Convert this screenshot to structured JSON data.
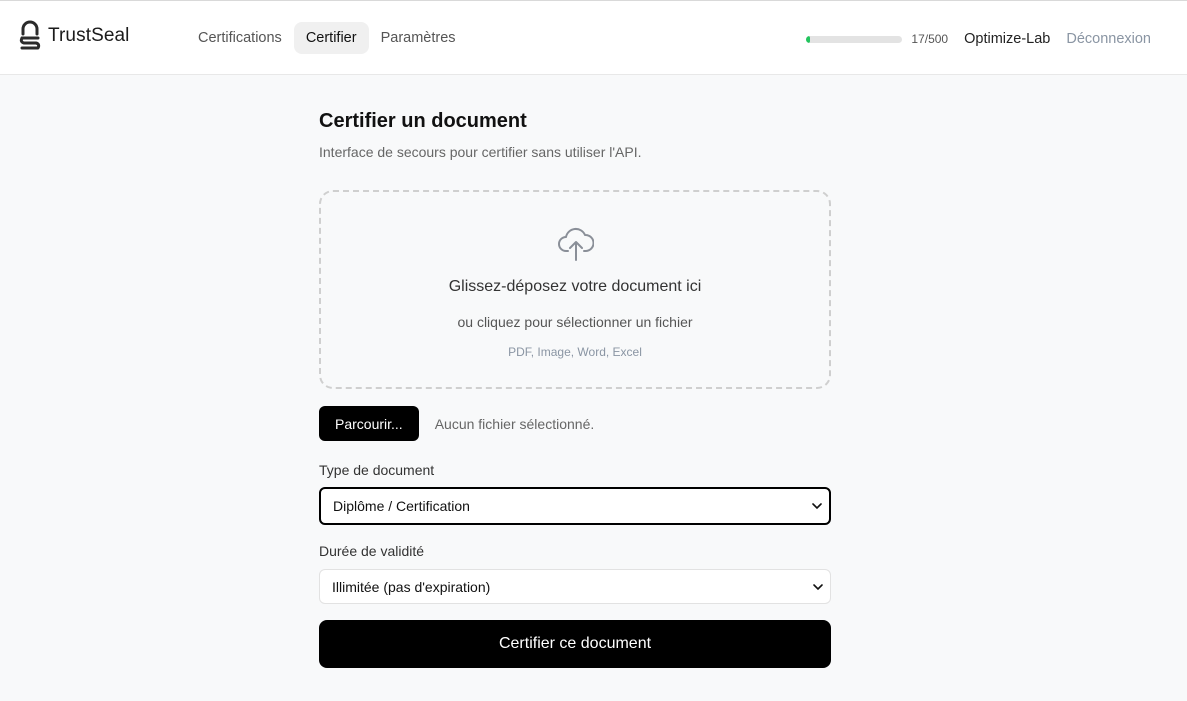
{
  "brand": {
    "name": "TrustSeal"
  },
  "nav": {
    "tabs": [
      {
        "label": "Certifications",
        "active": false
      },
      {
        "label": "Certifier",
        "active": true
      },
      {
        "label": "Paramètres",
        "active": false
      }
    ]
  },
  "account": {
    "quota_text": "17/500",
    "quota_fraction": 0.034,
    "organization": "Optimize-Lab",
    "logout_label": "Déconnexion"
  },
  "page": {
    "title": "Certifier un document",
    "subtitle": "Interface de secours pour certifier sans utiliser l'API."
  },
  "dropzone": {
    "title": "Glissez-déposez votre document ici",
    "subtitle": "ou cliquez pour sélectionner un fichier",
    "formats": "PDF, Image, Word, Excel",
    "icon": "cloud-upload-icon"
  },
  "file_input": {
    "button_label": "Parcourir...",
    "status": "Aucun fichier sélectionné."
  },
  "form": {
    "type_label": "Type de document",
    "type_value": "Diplôme / Certification",
    "validity_label": "Durée de validité",
    "validity_value": "Illimitée (pas d'expiration)",
    "submit_label": "Certifier ce document"
  },
  "colors": {
    "accent": "#000000",
    "quota_fill": "#22c55e",
    "muted": "#8a95a3"
  }
}
